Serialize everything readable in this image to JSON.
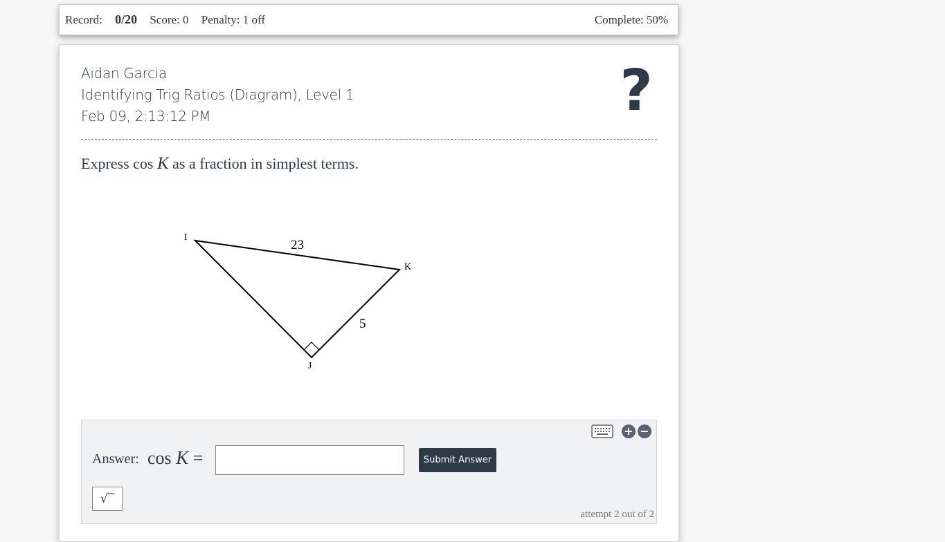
{
  "topbar": {
    "record_label": "Record:",
    "record_value": "0/20",
    "score": "Score: 0",
    "penalty": "Penalty: 1 off",
    "complete": "Complete: 50%"
  },
  "header": {
    "student": "Aidan Garcia",
    "assignment": "Identifying Trig Ratios (Diagram), Level 1",
    "timestamp": "Feb 09, 2:13:12 PM",
    "help_label": "?"
  },
  "question": {
    "prefix": "Express cos ",
    "variable": "K",
    "suffix": " as a fraction in simplest terms."
  },
  "diagram": {
    "vertices": [
      "I",
      "J",
      "K"
    ],
    "side_IK": "23",
    "side_JK": "5"
  },
  "answer": {
    "label": "Answer:",
    "math_prefix": "cos ",
    "math_var": "K",
    "math_eq": " =",
    "submit_label": "Submit Answer",
    "sqrt_label": "√‾",
    "attempt_text": "attempt 2 out of 2",
    "icons": [
      "keyboard-icon",
      "zoom-in-icon",
      "zoom-out-icon"
    ]
  }
}
